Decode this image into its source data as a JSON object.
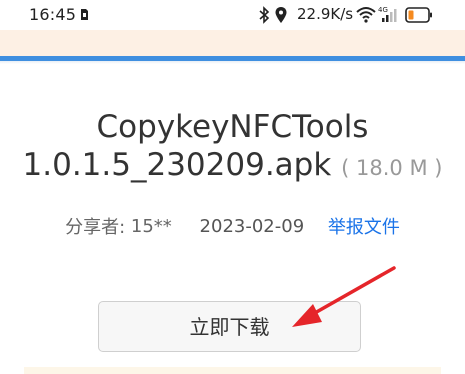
{
  "status_bar": {
    "time": "16:45",
    "left_icon": "sim-card-icon",
    "network_speed": "22.9K/s",
    "right_icons": [
      "bluetooth-icon",
      "location-icon",
      "wifi-icon",
      "signal-4g-icon",
      "battery-low-icon"
    ],
    "battery_color": "#f58a1f"
  },
  "header": {
    "band_color": "#fdf0e4",
    "accent_color": "#3f8fe0"
  },
  "file": {
    "name_line1": "CopykeyNFCTools",
    "name_line2": "1.0.1.5_230209.apk",
    "size": "( 18.0 M )"
  },
  "meta": {
    "sharer_label": "分享者:",
    "sharer": "15**",
    "date": "2023-02-09",
    "report_label": "举报文件",
    "link_color": "#1a73e8"
  },
  "download": {
    "label": "立即下载"
  },
  "annotation": {
    "arrow_color": "#e5252a"
  }
}
